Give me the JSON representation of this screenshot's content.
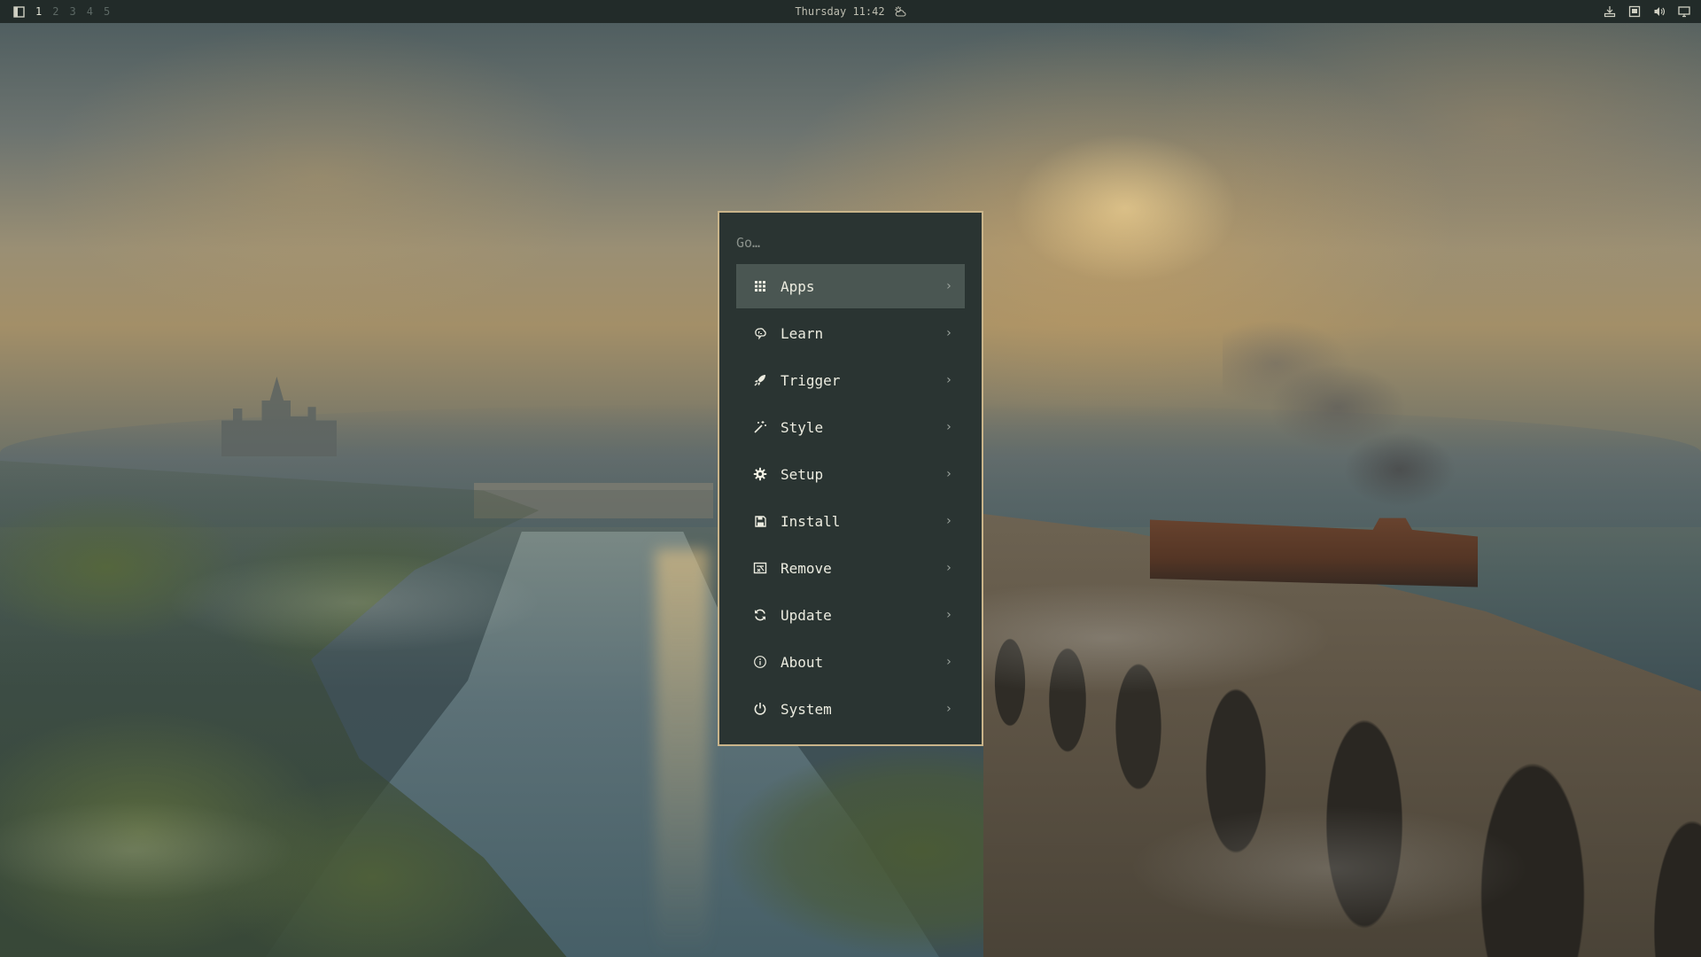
{
  "topbar": {
    "workspaces": [
      "1",
      "2",
      "3",
      "4",
      "5"
    ],
    "active_workspace": "1",
    "clock": "Thursday 11:42"
  },
  "icons": {
    "launcher": "window-icon",
    "weather": "cloud-sun-icon",
    "tray": [
      "download-tray-icon",
      "screen-icon",
      "volume-icon",
      "display-icon"
    ]
  },
  "menu": {
    "search_placeholder": "Go…",
    "selected_index": 0,
    "chevron": "›",
    "items": [
      {
        "label": "Apps",
        "icon": "grid-icon"
      },
      {
        "label": "Learn",
        "icon": "brain-icon"
      },
      {
        "label": "Trigger",
        "icon": "rocket-icon"
      },
      {
        "label": "Style",
        "icon": "magic-wand-icon"
      },
      {
        "label": "Setup",
        "icon": "gear-icon"
      },
      {
        "label": "Install",
        "icon": "save-icon"
      },
      {
        "label": "Remove",
        "icon": "remove-box-icon"
      },
      {
        "label": "Update",
        "icon": "refresh-icon"
      },
      {
        "label": "About",
        "icon": "info-icon"
      },
      {
        "label": "System",
        "icon": "power-icon"
      }
    ]
  },
  "colors": {
    "topbar_bg": "#222b29",
    "menu_bg": "#2a3432",
    "menu_border": "#c9b48a",
    "selected_bg": "#4a5652",
    "text": "#ecece0"
  }
}
